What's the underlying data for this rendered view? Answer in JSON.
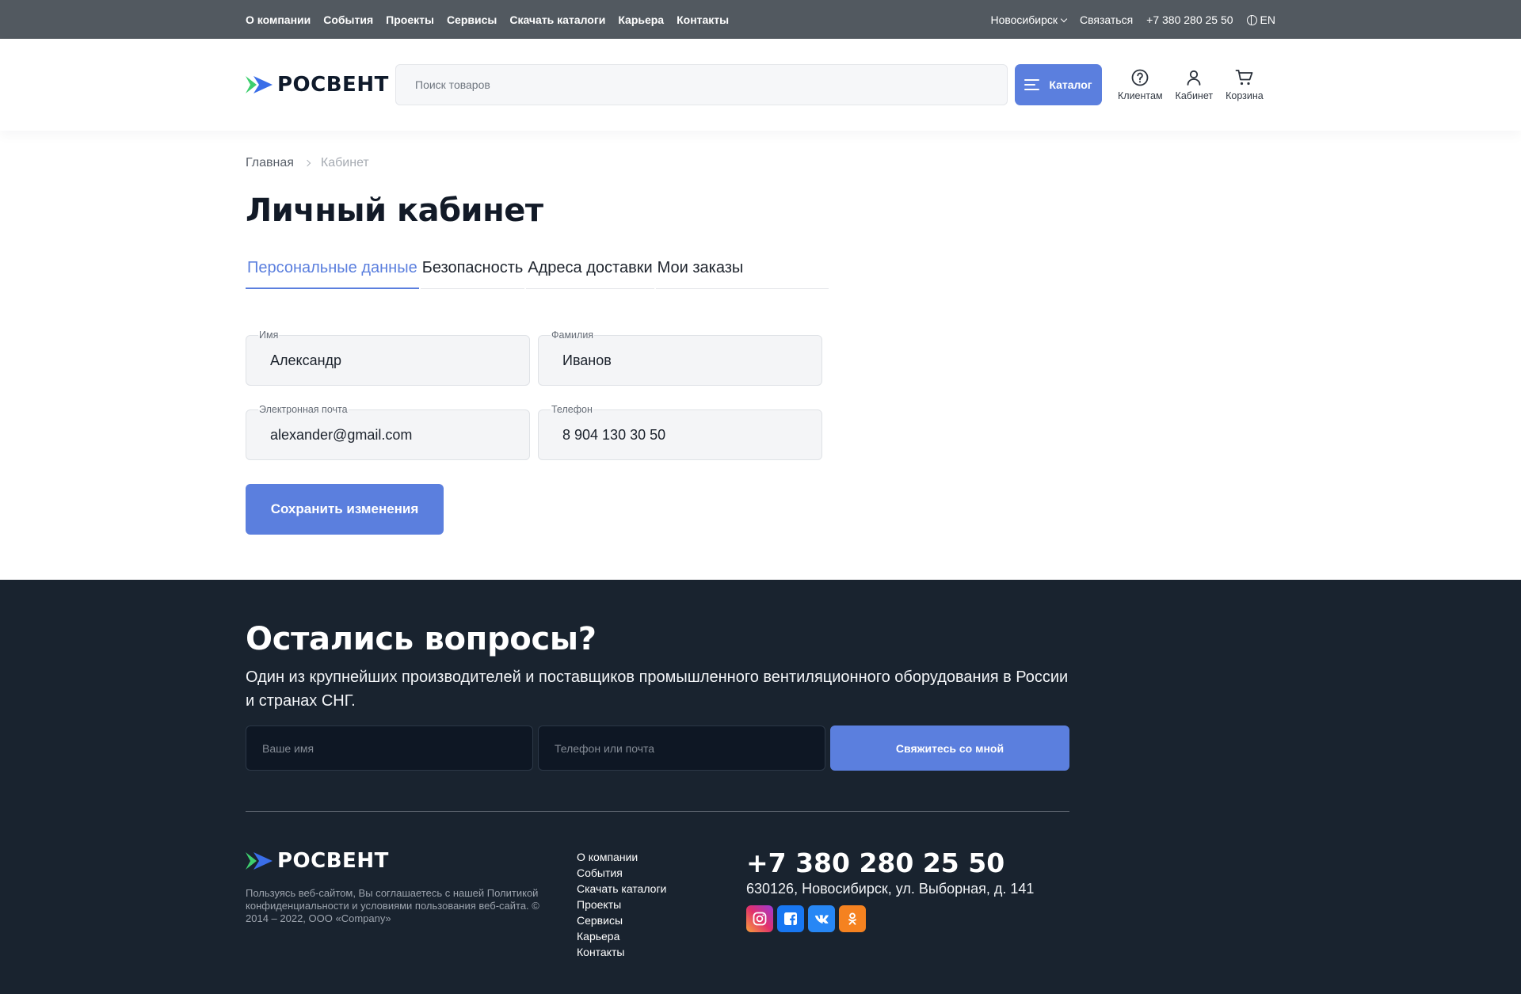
{
  "topbar": {
    "nav": [
      "О компании",
      "События",
      "Проекты",
      "Сервисы",
      "Скачать каталоги",
      "Карьера",
      "Контакты"
    ],
    "city": "Новосибирск",
    "contact_label": "Связаться",
    "phone": "+7 380 280 25 50",
    "lang": "EN"
  },
  "header": {
    "logo_text": "РОСВЕНТ",
    "search_placeholder": "Поиск товаров",
    "catalog_label": "Каталог",
    "icons": {
      "clients": "Клиентам",
      "cabinet": "Кабинет",
      "cart": "Корзина"
    }
  },
  "breadcrumb": {
    "home": "Главная",
    "current": "Кабинет"
  },
  "page": {
    "title": "Личный кабинет",
    "tabs": [
      "Персональные данные",
      "Безопасность",
      "Адреса доставки",
      "Мои заказы"
    ],
    "active_tab": 0
  },
  "form": {
    "first_name": {
      "label": "Имя",
      "value": "Александр"
    },
    "last_name": {
      "label": "Фамилия",
      "value": "Иванов"
    },
    "email": {
      "label": "Электронная почта",
      "value": "alexander@gmail.com"
    },
    "phone": {
      "label": "Телефон",
      "value": "8 904 130 30 50"
    },
    "save_label": "Сохранить изменения"
  },
  "footer": {
    "title": "Остались вопросы?",
    "subtitle": "Один из крупнейших производителей и поставщиков промышленного вентиляционного оборудования в России и странах СНГ.",
    "name_placeholder": "Ваше имя",
    "contact_placeholder": "Телефон или почта",
    "submit_label": "Свяжитесь со мной",
    "logo_text": "РОСВЕНТ",
    "legal": "Пользуясь веб-сайтом, Вы соглашаетесь с нашей Политикой конфиденциальности и условиями пользования веб-сайта. © 2014 – 2022, ООО «Company»",
    "links": [
      "О компании",
      "События",
      "Скачать каталоги",
      "Проекты",
      "Сервисы",
      "Карьера",
      "Контакты"
    ],
    "phone": "+7 380 280 25 50",
    "address": "630126, Новосибирск, ул. Выборная, д. 141",
    "socials": [
      "instagram-icon",
      "facebook-icon",
      "vk-icon",
      "odnoklassniki-icon"
    ]
  },
  "colors": {
    "accent": "#5b7fde",
    "topbar": "#525960",
    "footer": "#19232f",
    "logo_green": "#3ecf6e",
    "logo_blue": "#3a6ee8"
  }
}
